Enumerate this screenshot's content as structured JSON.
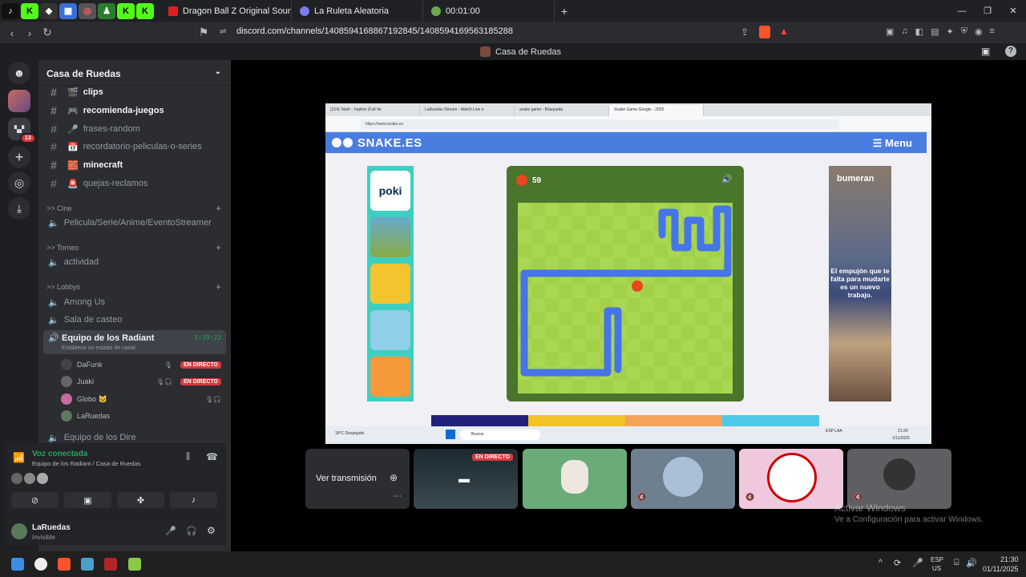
{
  "browser": {
    "tabs": [
      {
        "label": "Dragon Ball Z Original Soundtrac",
        "color": "#e02020"
      },
      {
        "label": "La Ruleta Aleatoria",
        "color": "#7a7cf0"
      },
      {
        "label": "00:01:00",
        "color": "#6aa84f"
      }
    ],
    "url": "discord.com/channels/1408594168867192845/1408594169563185288",
    "new_tab": "+"
  },
  "discord": {
    "title": "Casa de Ruedas",
    "server_name": "Casa de Ruedas",
    "server_badge": "13",
    "text_channels": [
      {
        "name": "clips",
        "bold": true,
        "emoji": "🎬"
      },
      {
        "name": "recomienda-juegos",
        "bold": true,
        "emoji": "🎮"
      },
      {
        "name": "frases-random",
        "bold": false,
        "emoji": "🎤"
      },
      {
        "name": "recordatorio-peliculas-o-series",
        "bold": false,
        "emoji": "📅"
      },
      {
        "name": "minecraft",
        "bold": true,
        "emoji": "🧱"
      },
      {
        "name": "quejas-reclamos",
        "bold": false,
        "emoji": "🚨"
      }
    ],
    "cat_cine": ">> Cine",
    "ch_cine": "Pelicula/Serie/Anime/EventoStreamer",
    "cat_torneo": ">> Torneo",
    "ch_actividad": "actividad",
    "cat_lobbys": ">> Lobbys",
    "ch_among": "Among Us",
    "ch_casteo": "Sala de casteo",
    "ch_radiant": "Equipo de los Radiant",
    "radiant_timer": "1:39:22",
    "radiant_status": "Establece un estado de canal",
    "members": [
      {
        "name": "DaFunk",
        "live": "EN DIRECTO"
      },
      {
        "name": "Juaki",
        "live": "EN DIRECTO"
      },
      {
        "name": "Globo 🐱",
        "live": ""
      },
      {
        "name": "LaRuedas",
        "live": ""
      }
    ],
    "ch_dire": "Equipo de los Dire",
    "voice_connected": "Voz conectada",
    "voice_location": "Equipo de los Radiant / Casa de Ruedas",
    "user_name": "LaRuedas",
    "user_status": "Invisible",
    "ver_transmision": "Ver transmisión",
    "en_directo": "EN DIRECTO"
  },
  "screen": {
    "tabs": [
      "(214) Tatsh - Xepher (Full Ve",
      "LaRuedas Stream - Watch Live o",
      "snake game - Búsqueda",
      "Snake Game Google - 2025"
    ],
    "url": "https://www.snake.es",
    "logo": "SNAKE.ES",
    "menu": "☰ Menu",
    "score": "59",
    "ad_brand": "bumeran",
    "ad_text": "El empujón que te falta para mudarte es un nuevo trabajo.",
    "weather": "18°C Despejado",
    "search": "Buscar",
    "lang": "ESP LAA",
    "time": "21:29",
    "date": "1/11/2025"
  },
  "watermark": {
    "title": "Activar Windows",
    "subtitle": "Ve a Configuración para activar Windows."
  },
  "taskbar": {
    "lang": "ESP",
    "layout": "US",
    "time": "21:30",
    "date": "01/11/2025"
  }
}
